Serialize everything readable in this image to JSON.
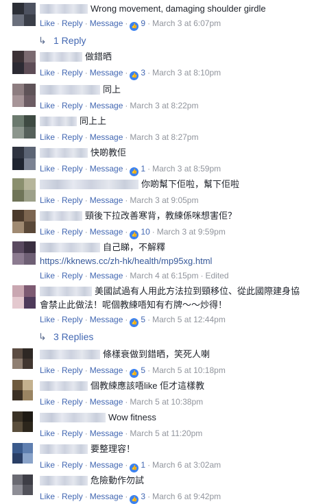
{
  "actions": {
    "like": "Like",
    "reply": "Reply",
    "message": "Message",
    "dot": "·"
  },
  "icons": {
    "like_badge": "thumbs-up-icon",
    "reply_arrow": "reply-arrow-icon"
  },
  "colors": {
    "link": "#4267b2",
    "meta": "#90949c",
    "text": "#1d2129",
    "like_badge": "#3b82f0"
  },
  "comments": [
    {
      "text": "Wrong movement, damaging shoulder girdle",
      "likes": "9",
      "time": "March 3 at 6:07pm"
    },
    {
      "text": "做錯晒",
      "likes": "3",
      "time": "March 3 at 8:10pm"
    },
    {
      "text": "同上",
      "likes": "",
      "time": "March 3 at 8:22pm"
    },
    {
      "text": "同上上",
      "likes": "",
      "time": "March 3 at 8:27pm"
    },
    {
      "text": "快啲教佢",
      "likes": "1",
      "time": "March 3 at 8:59pm"
    },
    {
      "text": "你啲幫下佢啦，幫下佢啦",
      "likes": "",
      "time": "March 3 at 9:05pm"
    },
    {
      "text": "頸後下拉改善寒背，教練係咪想害佢？",
      "likes": "10",
      "time": "March 3 at 9:59pm"
    },
    {
      "text": "自己睇，不解釋",
      "text2": "https://kknews.cc/zh-hk/health/mp95xg.html",
      "likes": "",
      "time": "March 4 at 6:15pm",
      "edited": "Edited"
    },
    {
      "text": "美國試過有人用此方法拉到頸移位、從此國際建身協",
      "text2": "會禁止此做法！呢個教練唔知有冇牌～～炒得！",
      "likes": "5",
      "time": "March 5 at 12:44pm"
    },
    {
      "text": "條樣衰做到錯晒，笑死人喇",
      "likes": "5",
      "time": "March 5 at 10:18pm"
    },
    {
      "text": "個教練應該唔like 佢才這樣教",
      "likes": "",
      "time": "March 5 at 10:38pm"
    },
    {
      "text": "Wow fitness",
      "likes": "",
      "time": "March 5 at 11:20pm"
    },
    {
      "text": "要整理容！",
      "likes": "1",
      "time": "March 6 at 3:02am"
    },
    {
      "text": "危險動作勿試",
      "likes": "3",
      "time": "March 6 at 9:42pm"
    }
  ],
  "reply_links": [
    {
      "label": "1 Reply"
    },
    {
      "label": "3 Replies"
    }
  ]
}
